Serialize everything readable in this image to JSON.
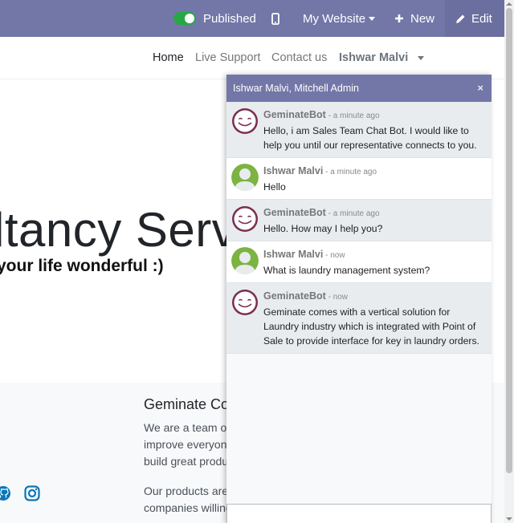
{
  "topbar": {
    "published_label": "Published",
    "website_label": "My Website",
    "new_label": "New",
    "edit_label": "Edit",
    "bar_color": "#7277a8"
  },
  "nav": {
    "home": "Home",
    "live_support": "Live Support",
    "contact_us": "Contact us",
    "user": "Ishwar Malvi"
  },
  "hero": {
    "title": "ltancy Serv",
    "subtitle": "your life wonderful :)"
  },
  "footer": {
    "heading": "Geminate Co",
    "lines": [
      "We are a team o",
      "improve everyon",
      "build great produ",
      "Our products are",
      "companies willing"
    ]
  },
  "chat": {
    "header": "Ishwar Malvi, Mitchell Admin",
    "close": "×",
    "messages": [
      {
        "author": "GeminateBot",
        "time": "a minute ago",
        "kind": "bot",
        "text": "Hello, i am Sales Team Chat Bot. I would like to help you until our representative connects to you."
      },
      {
        "author": "Ishwar Malvi",
        "time": "a minute ago",
        "kind": "user",
        "text": "Hello"
      },
      {
        "author": "GeminateBot",
        "time": "a minute ago",
        "kind": "bot",
        "text": "Hello. How may I help you?"
      },
      {
        "author": "Ishwar Malvi",
        "time": "now",
        "kind": "user",
        "text": "What is laundry management system?"
      },
      {
        "author": "GeminateBot",
        "time": "now",
        "kind": "bot",
        "text": "Geminate comes with a vertical solution for Laundry industry which is integrated with Point of Sale to provide interface for key in laundry orders."
      }
    ]
  }
}
